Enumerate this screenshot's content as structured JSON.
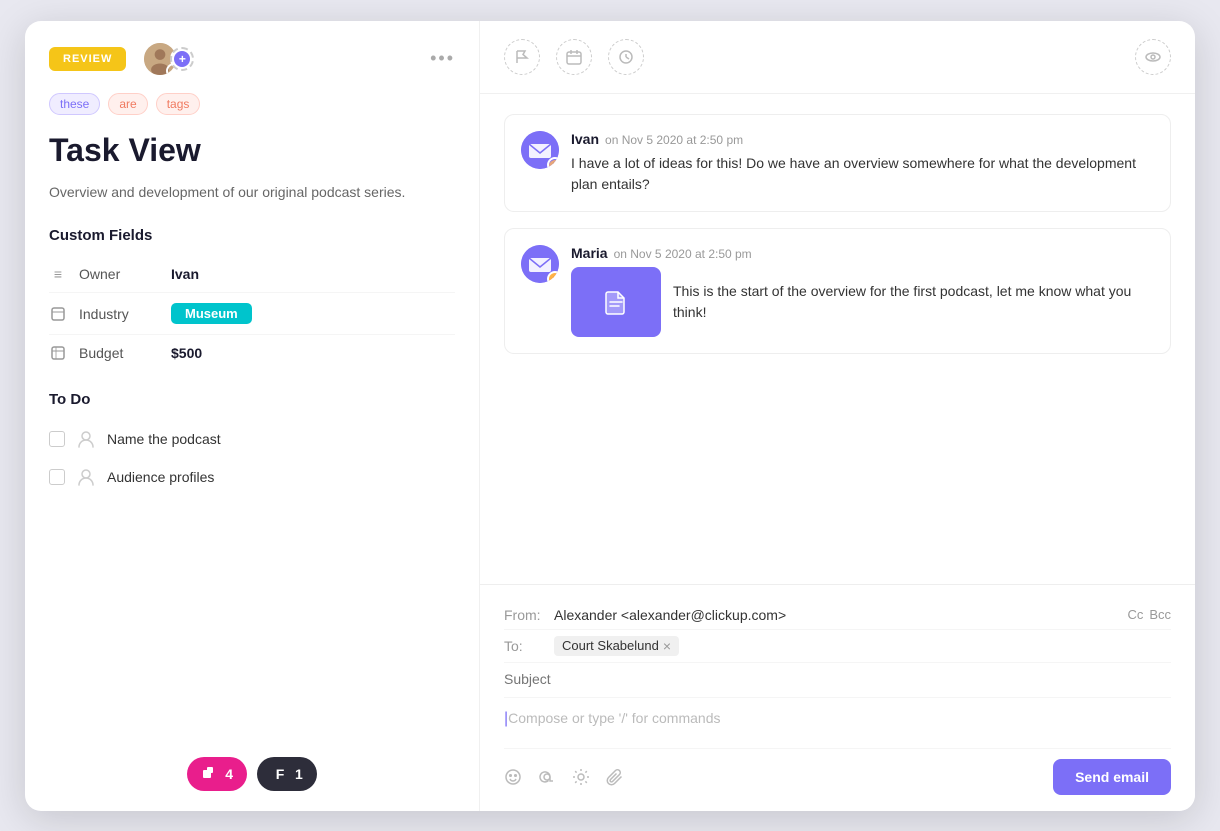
{
  "header": {
    "review_label": "REVIEW",
    "more_dots": "•••"
  },
  "tags": [
    {
      "label": "these",
      "class": "tag-these"
    },
    {
      "label": "are",
      "class": "tag-are"
    },
    {
      "label": "tags",
      "class": "tag-tags"
    }
  ],
  "task": {
    "title": "Task View",
    "description": "Overview and development of our original podcast series."
  },
  "custom_fields": {
    "section_title": "Custom Fields",
    "fields": [
      {
        "icon": "≡",
        "label": "Owner",
        "value": "Ivan",
        "type": "text"
      },
      {
        "icon": "□",
        "label": "Industry",
        "value": "Museum",
        "type": "badge"
      },
      {
        "icon": "□",
        "label": "Budget",
        "value": "$500",
        "type": "text"
      }
    ]
  },
  "todo": {
    "section_title": "To Do",
    "items": [
      {
        "text": "Name the podcast"
      },
      {
        "text": "Audience profiles"
      }
    ]
  },
  "bottom_badges": [
    {
      "count": "4",
      "icon": "🔔",
      "color": "pink"
    },
    {
      "count": "1",
      "icon": "F",
      "color": "dark"
    }
  ],
  "comments": [
    {
      "author": "Ivan",
      "time": "on Nov 5 2020 at 2:50 pm",
      "text": "I have a lot of ideas for this! Do we have an overview somewhere for what the development plan entails?",
      "has_attachment": false
    },
    {
      "author": "Maria",
      "time": "on Nov 5 2020 at 2:50 pm",
      "text": "This is the start of the overview for the first podcast, let me know what you think!",
      "has_attachment": true
    }
  ],
  "email": {
    "from_label": "From:",
    "from_value": "Alexander <alexander@clickup.com>",
    "to_label": "To:",
    "to_value": "Court Skabelund",
    "cc_label": "Cc",
    "bcc_label": "Bcc",
    "subject_placeholder": "Subject",
    "compose_placeholder": "Compose or type '/' for commands",
    "send_label": "Send email"
  }
}
